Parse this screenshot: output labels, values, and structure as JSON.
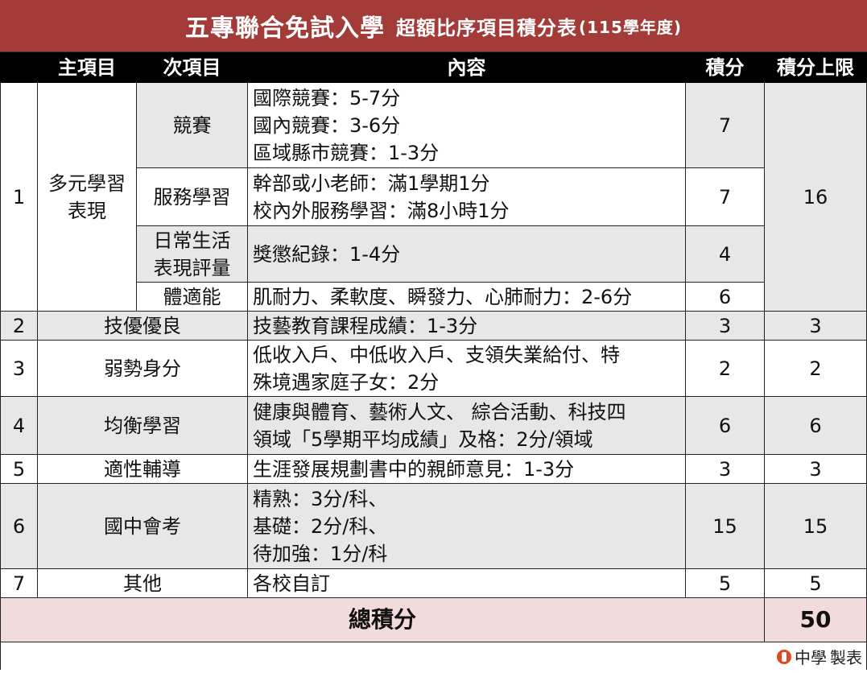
{
  "title": {
    "main": "五專聯合免試入學",
    "sub": "超額比序項目積分表",
    "year": "(115學年度)"
  },
  "headers": {
    "main_item": "主項目",
    "sub_item": "次項目",
    "content": "內容",
    "score": "積分",
    "limit": "積分上限"
  },
  "rows": {
    "r1": {
      "no": "1",
      "main": [
        "多元學習",
        "表現"
      ],
      "limit": "16",
      "subs": [
        {
          "name": [
            "競賽"
          ],
          "content": [
            "國際競賽：5-7分",
            "國內競賽：3-6分",
            "區域縣市競賽：1-3分"
          ],
          "score": "7"
        },
        {
          "name": [
            "服務學習"
          ],
          "content": [
            "幹部或小老師：滿1學期1分",
            "校內外服務學習：滿8小時1分"
          ],
          "score": "7"
        },
        {
          "name": [
            "日常生活",
            "表現評量"
          ],
          "content": [
            "獎懲紀錄：1-4分"
          ],
          "score": "4"
        },
        {
          "name": [
            "體適能"
          ],
          "content": [
            "肌耐力、柔軟度、瞬發力、心肺耐力：2-6分"
          ],
          "score": "6"
        }
      ]
    },
    "r2": {
      "no": "2",
      "main": "技優優良",
      "content": [
        "技藝教育課程成績：1-3分"
      ],
      "score": "3",
      "limit": "3"
    },
    "r3": {
      "no": "3",
      "main": "弱勢身分",
      "content": [
        "低收入戶、中低收入戶、支領失業給付、特",
        "殊境遇家庭子女：2分"
      ],
      "score": "2",
      "limit": "2"
    },
    "r4": {
      "no": "4",
      "main": "均衡學習",
      "content": [
        "健康與體育、藝術人文、 綜合活動、科技四",
        "領域「5學期平均成績」及格：2分/領域"
      ],
      "score": "6",
      "limit": "6"
    },
    "r5": {
      "no": "5",
      "main": "適性輔導",
      "content": [
        "生涯發展規劃書中的親師意見：1-3分"
      ],
      "score": "3",
      "limit": "3"
    },
    "r6": {
      "no": "6",
      "main": "國中會考",
      "content": [
        "精熟：3分/科、",
        "基礎：2分/科、",
        "待加強：1分/科"
      ],
      "score": "15",
      "limit": "15"
    },
    "r7": {
      "no": "7",
      "main": "其他",
      "content": [
        "各校自訂"
      ],
      "score": "5",
      "limit": "5"
    }
  },
  "total": {
    "label": "總積分",
    "value": "50"
  },
  "brand": {
    "name": "中學",
    "suffix": "製表",
    "logo_icon": "orange-circle-logo-icon"
  },
  "colors": {
    "title_bg": "#a33b38",
    "header_bg": "#000000",
    "gray_row": "#e7e7e7",
    "total_bg": "#f2dcdb"
  }
}
